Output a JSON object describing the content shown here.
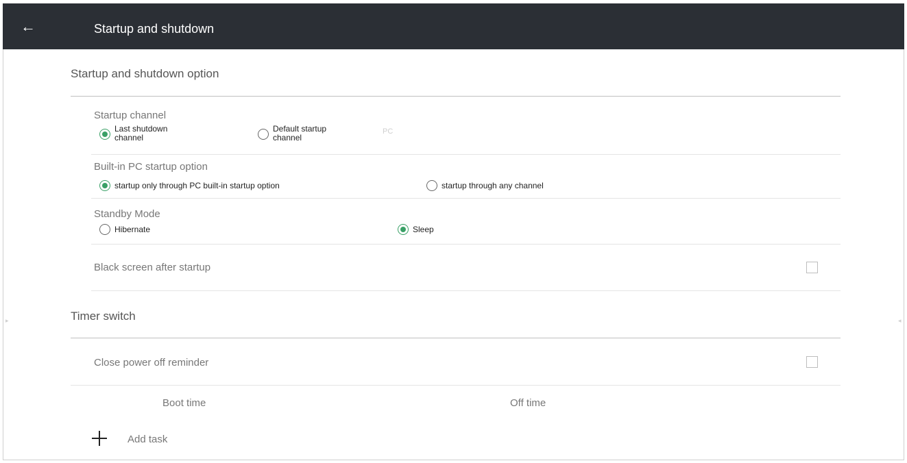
{
  "header": {
    "title": "Startup and shutdown",
    "back_glyph": "←"
  },
  "section1": {
    "title": "Startup and shutdown option"
  },
  "startup_channel": {
    "label": "Startup channel",
    "options": [
      {
        "line1": "Last shutdown",
        "line2": "channel",
        "selected": true
      },
      {
        "line1": "Default startup",
        "line2": "channel",
        "selected": false
      }
    ],
    "value": "PC"
  },
  "builtin_pc": {
    "label": "Built-in PC startup option",
    "options": [
      {
        "label": "startup only through PC built-in startup option",
        "selected": true
      },
      {
        "label": "startup through any channel",
        "selected": false
      }
    ]
  },
  "standby": {
    "label": "Standby Mode",
    "options": [
      {
        "label": "Hibernate",
        "selected": false
      },
      {
        "label": "Sleep",
        "selected": true
      }
    ]
  },
  "black_screen": {
    "label": "Black screen after startup",
    "checked": false
  },
  "section2": {
    "title": "Timer switch"
  },
  "power_off_reminder": {
    "label": "Close power off reminder",
    "checked": false
  },
  "timer_table": {
    "columns": [
      "Boot time",
      "Off time"
    ]
  },
  "add_task": {
    "label": "Add task"
  },
  "colors": {
    "header_bg": "#2b2f35",
    "accent": "#3aa066"
  }
}
